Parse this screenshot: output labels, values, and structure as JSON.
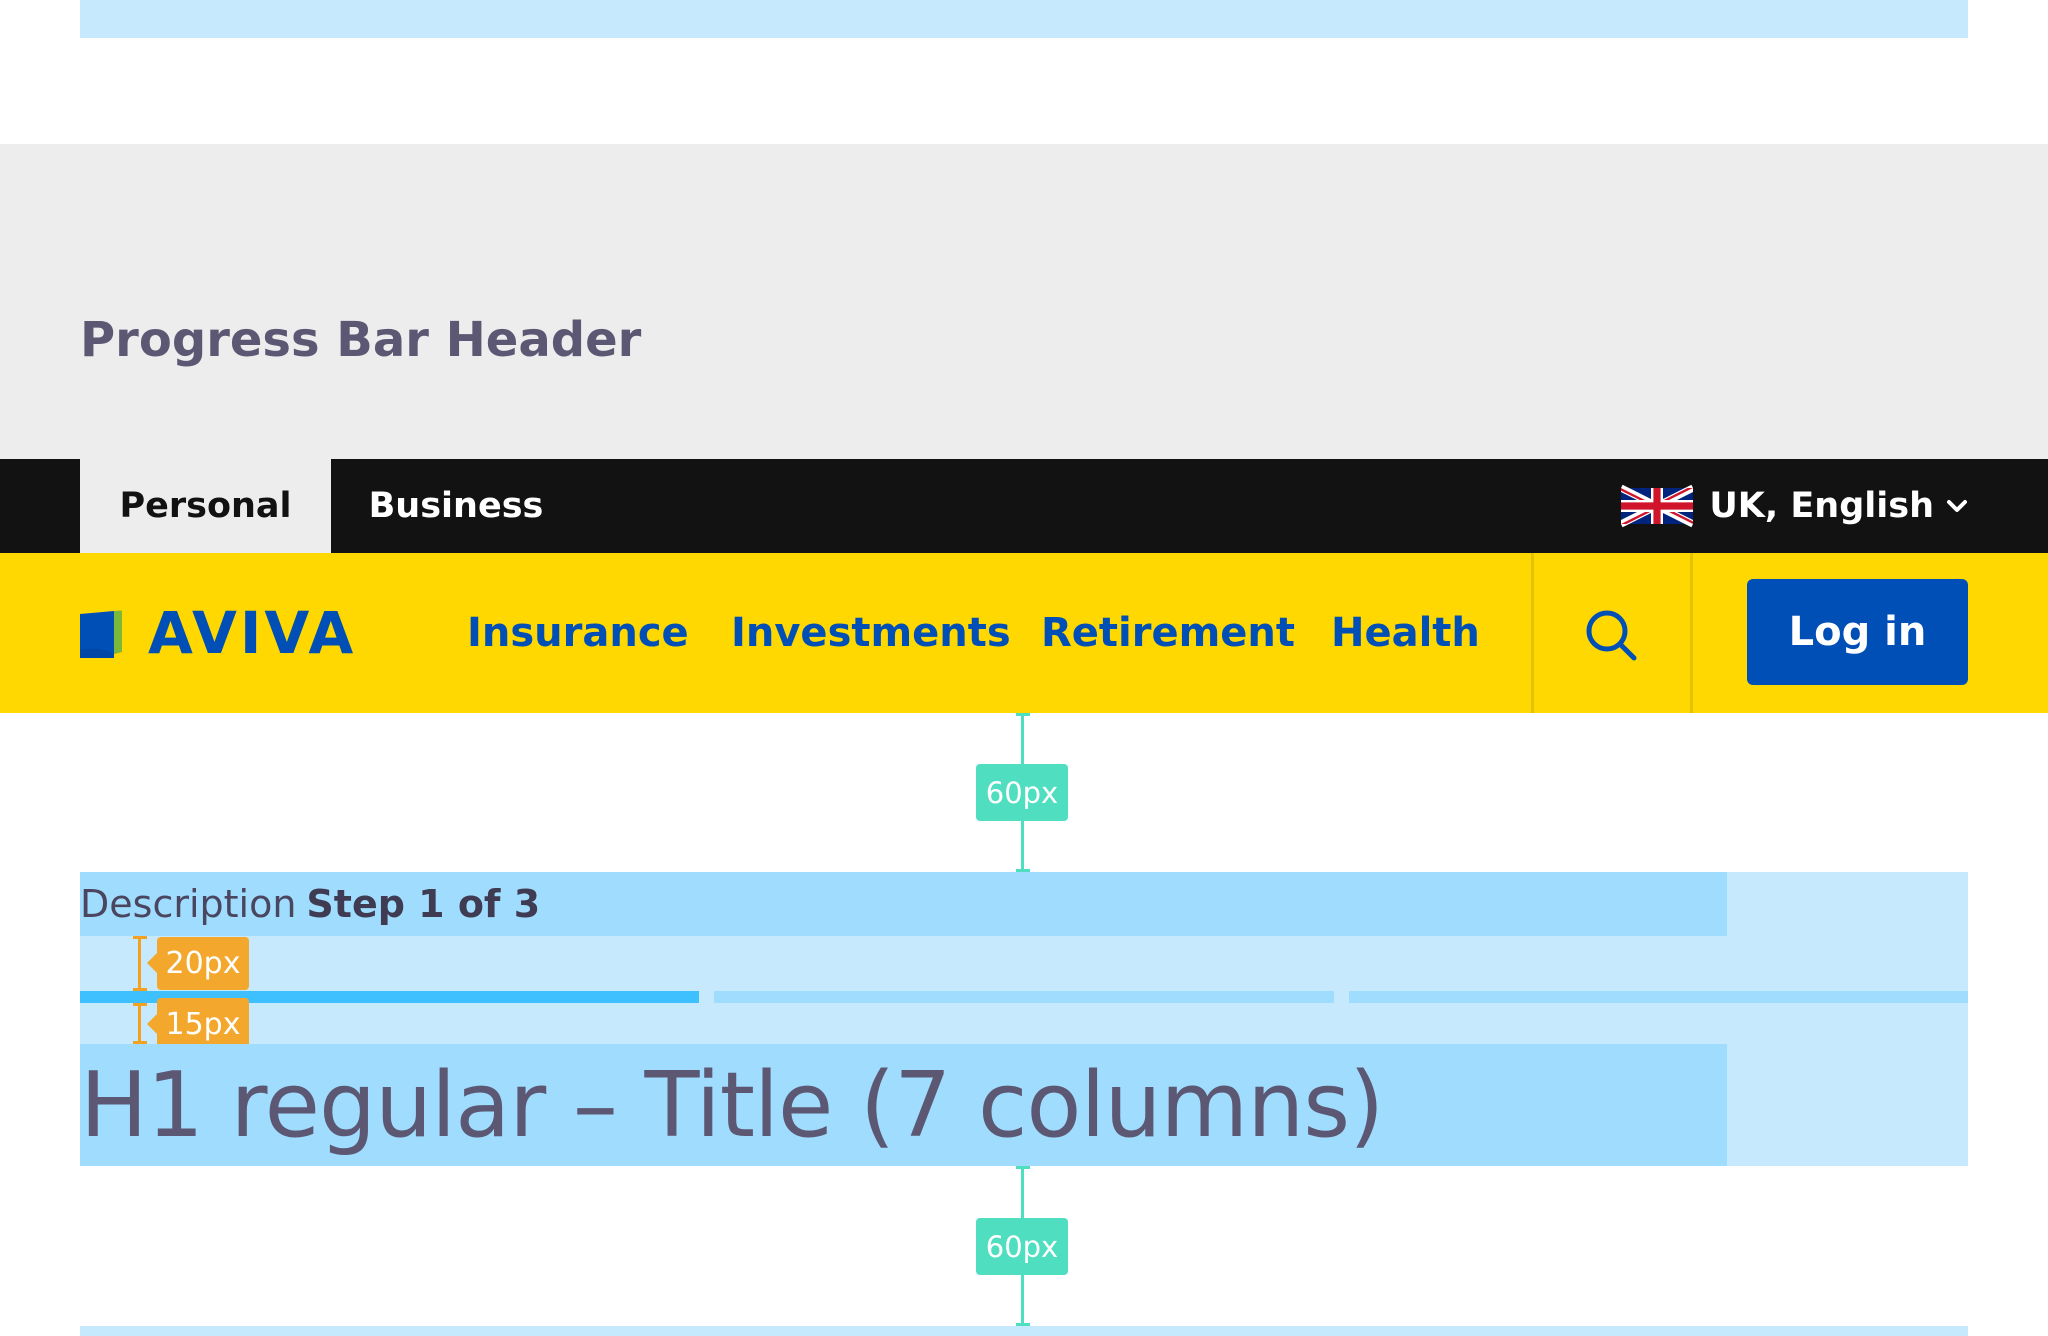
{
  "section": {
    "title": "Progress Bar Header"
  },
  "utility_bar": {
    "tabs": [
      {
        "label": "Personal",
        "active": true
      },
      {
        "label": "Business",
        "active": false
      }
    ],
    "language": {
      "label": "UK, English",
      "flag_icon": "uk-flag-icon",
      "dropdown_icon": "chevron-down-icon"
    }
  },
  "main_nav": {
    "logo_text": "AVIVA",
    "items": [
      {
        "label": "Insurance"
      },
      {
        "label": "Investments"
      },
      {
        "label": "Retirement"
      },
      {
        "label": "Health"
      }
    ],
    "search_icon": "search-icon",
    "login_label": "Log in"
  },
  "progress": {
    "description": "Description",
    "step_text": "Step 1 of 3",
    "current_step": 1,
    "total_steps": 3,
    "title": "H1 regular – Title (7 columns)"
  },
  "annotations": {
    "top_spacing": "60px",
    "bottom_spacing": "60px",
    "desc_gap": "20px",
    "bar_gap": "15px"
  },
  "colors": {
    "brand_yellow": "#fed800",
    "brand_blue": "#004fb6",
    "utility_black": "#121212",
    "progress_active": "#3ec0fe",
    "progress_inactive": "#9fdcfd",
    "spacing_annotation": "#4fdec0",
    "measure_annotation": "#f4a72d"
  }
}
